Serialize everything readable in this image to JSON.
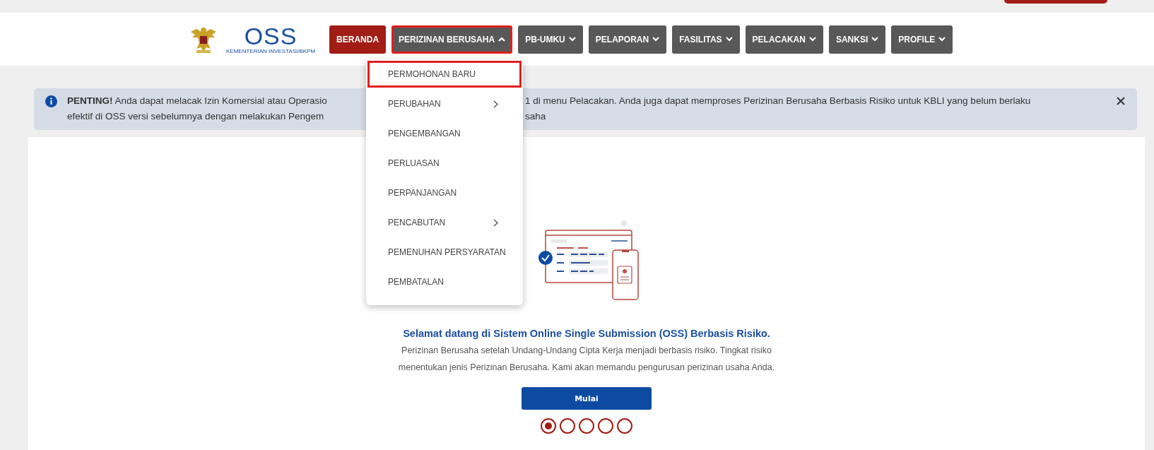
{
  "logo": {
    "name": "OSS",
    "subtitle": "KEMENTERIAN INVESTASI/BKPM"
  },
  "nav": [
    {
      "label": "BERANDA",
      "kind": "link",
      "selected": true,
      "expanded": false
    },
    {
      "label": "PERIZINAN BERUSAHA",
      "kind": "menu",
      "selected": false,
      "expanded": true
    },
    {
      "label": "PB-UMKU",
      "kind": "menu",
      "selected": false,
      "expanded": false
    },
    {
      "label": "PELAPORAN",
      "kind": "menu",
      "selected": false,
      "expanded": false
    },
    {
      "label": "FASILITAS",
      "kind": "menu",
      "selected": false,
      "expanded": false
    },
    {
      "label": "PELACAKAN",
      "kind": "menu",
      "selected": false,
      "expanded": false
    },
    {
      "label": "SANKSI",
      "kind": "menu",
      "selected": false,
      "expanded": false
    },
    {
      "label": "PROFILE",
      "kind": "menu",
      "selected": false,
      "expanded": false
    }
  ],
  "dropdown": [
    {
      "label": "PERMOHONAN BARU",
      "kind": "item",
      "selected": true
    },
    {
      "label": "PERUBAHAN",
      "kind": "submenu",
      "selected": false
    },
    {
      "label": "PENGEMBANGAN",
      "kind": "item",
      "selected": false
    },
    {
      "label": "PERLUASAN",
      "kind": "item",
      "selected": false
    },
    {
      "label": "PERPANJANGAN",
      "kind": "item",
      "selected": false
    },
    {
      "label": "PENCABUTAN",
      "kind": "submenu",
      "selected": false
    },
    {
      "label": "PEMENUHAN PERSYARATAN",
      "kind": "item",
      "selected": false
    },
    {
      "label": "PEMBATALAN",
      "kind": "item",
      "selected": false
    }
  ],
  "alert": {
    "lines": [
      [
        "**PENTING!** Anda dapat melacak Izin Komersial atau Operasio",
        "1 di menu Pelacakan. Anda juga dapat memproses Perizinan Berusaha Berbasis Risiko untuk KBLI yang belum berlaku"
      ],
      [
        "efektif di OSS versi sebelumnya dengan melakukan Pengem",
        "saha"
      ]
    ]
  },
  "welcome": {
    "title": "Selamat datang di Sistem Online Single Submission (OSS) Berbasis Risiko.",
    "text": "Perizinan Berusaha setelah Undang-Undang Cipta Kerja menjadi berbasis risiko. Tingkat risiko menentukan jenis Perizinan Berusaha. Kami akan memandu pengurusan perizinan usaha Anda.",
    "button": "Mulai"
  },
  "steps": [
    {
      "selected": true
    },
    {
      "selected": false
    },
    {
      "selected": false
    },
    {
      "selected": false
    },
    {
      "selected": false
    }
  ]
}
